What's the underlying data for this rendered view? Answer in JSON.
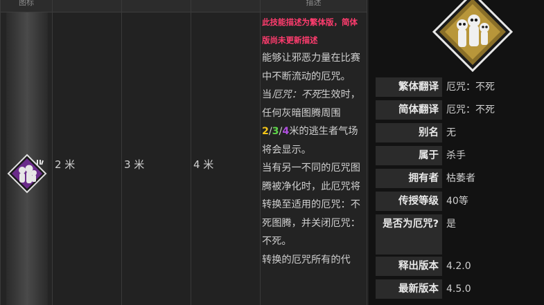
{
  "table": {
    "header_labels": [
      "图标",
      "",
      "",
      "",
      "描述"
    ],
    "values": [
      "2 米",
      "3 米",
      "4 米"
    ],
    "description": {
      "note": "此技能描述为繁体版，简体版尚未更新描述",
      "p1": "能够让邪恶力量在比赛中不断流动的厄咒。",
      "p2_a": "当",
      "p2_hex": "厄咒：不死",
      "p2_b": "生效时，任何灰暗图腾周围",
      "tier1": "2",
      "tier2": "3",
      "tier3": "4",
      "slash": "/",
      "p2_c": "米的逃生者气场将会显示。",
      "p3": "当有另一不同的厄咒图腾被净化时，此厄咒将转换至适用的厄咒：不死图腾，并关闭厄咒：不死。",
      "p4": "转换的厄咒所有的代"
    },
    "icon": "hex-undying-perk-icon"
  },
  "infobox": {
    "portrait": "skulls-portrait-icon",
    "rows": [
      {
        "label": "繁体翻译",
        "value": "厄咒：不死"
      },
      {
        "label": "简体翻译",
        "value": "厄咒：不死"
      },
      {
        "label": "别名",
        "value": "无"
      },
      {
        "label": "属于",
        "value": "杀手"
      },
      {
        "label": "拥有者",
        "value": "枯萎者"
      },
      {
        "label": "传授等级",
        "value": "40等"
      },
      {
        "label": "是否为厄咒?",
        "value": "是"
      },
      {
        "label": "释出版本",
        "value": "4.2.0"
      },
      {
        "label": "最新版本",
        "value": "4.5.0"
      }
    ]
  },
  "colors": {
    "tier1": "#f5c518",
    "tier2": "#5fd64a",
    "tier3": "#b04fe0",
    "note": "#ff3c6e",
    "owner": "#e8c98c"
  }
}
